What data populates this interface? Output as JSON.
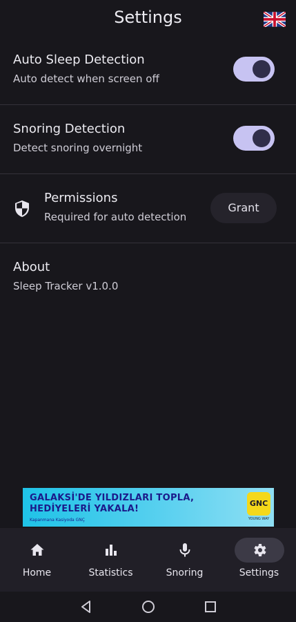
{
  "header": {
    "title": "Settings",
    "flag_icon": "uk-flag-icon"
  },
  "settings": {
    "auto_sleep": {
      "title": "Auto Sleep Detection",
      "subtitle": "Auto detect when screen off",
      "enabled": true
    },
    "snoring": {
      "title": "Snoring Detection",
      "subtitle": "Detect snoring overnight",
      "enabled": true
    },
    "permissions": {
      "title": "Permissions",
      "subtitle": "Required for auto detection",
      "button_label": "Grant",
      "icon": "shield-icon"
    },
    "about": {
      "title": "About",
      "subtitle": "Sleep Tracker v1.0.0"
    }
  },
  "ad": {
    "line1": "GALAKSİ'DE YILDIZLARI TOPLA,",
    "line2": "HEDİYELERİ YAKALA!",
    "small_print": "Kapanmana Kasiyoda GNÇ",
    "logo_text": "GNC",
    "logo_sub": "YOUNG WAY"
  },
  "bottom_nav": {
    "items": [
      {
        "label": "Home",
        "icon": "home-icon",
        "active": false
      },
      {
        "label": "Statistics",
        "icon": "bar-chart-icon",
        "active": false
      },
      {
        "label": "Snoring",
        "icon": "microphone-icon",
        "active": false
      },
      {
        "label": "Settings",
        "icon": "gear-icon",
        "active": true
      }
    ]
  },
  "colors": {
    "background": "#18171c",
    "toggle_track": "#c7c3f2",
    "toggle_knob": "#302e4a",
    "nav_background": "#211f27",
    "ad_blue": "#1fc3e7"
  }
}
